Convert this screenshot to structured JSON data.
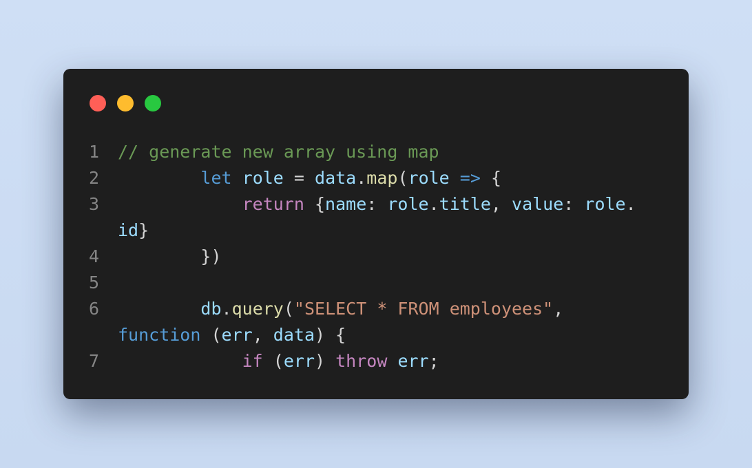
{
  "window_controls": {
    "close_color": "#ff5f57",
    "minimize_color": "#febc2e",
    "maximize_color": "#28c840"
  },
  "code": {
    "lines": [
      {
        "n": "1",
        "segments": [
          {
            "t": "// generate new array using map",
            "c": "comment"
          }
        ]
      },
      {
        "n": "2",
        "segments": [
          {
            "t": "        ",
            "c": "punc"
          },
          {
            "t": "let",
            "c": "kw"
          },
          {
            "t": " ",
            "c": "punc"
          },
          {
            "t": "role",
            "c": "var"
          },
          {
            "t": " = ",
            "c": "punc"
          },
          {
            "t": "data",
            "c": "var"
          },
          {
            "t": ".",
            "c": "punc"
          },
          {
            "t": "map",
            "c": "fn"
          },
          {
            "t": "(",
            "c": "punc"
          },
          {
            "t": "role",
            "c": "var"
          },
          {
            "t": " ",
            "c": "punc"
          },
          {
            "t": "=>",
            "c": "kw"
          },
          {
            "t": " {",
            "c": "punc"
          }
        ]
      },
      {
        "n": "3",
        "segments": [
          {
            "t": "            ",
            "c": "punc"
          },
          {
            "t": "return",
            "c": "ctrl"
          },
          {
            "t": " {",
            "c": "punc"
          },
          {
            "t": "name",
            "c": "var"
          },
          {
            "t": ": ",
            "c": "punc"
          },
          {
            "t": "role",
            "c": "var"
          },
          {
            "t": ".",
            "c": "punc"
          },
          {
            "t": "title",
            "c": "var"
          },
          {
            "t": ", ",
            "c": "punc"
          },
          {
            "t": "value",
            "c": "var"
          },
          {
            "t": ": ",
            "c": "punc"
          },
          {
            "t": "role",
            "c": "var"
          },
          {
            "t": ".",
            "c": "punc"
          }
        ]
      },
      {
        "n": "",
        "segments": [
          {
            "t": "id",
            "c": "var"
          },
          {
            "t": "}",
            "c": "punc"
          }
        ]
      },
      {
        "n": "4",
        "segments": [
          {
            "t": "        })",
            "c": "punc"
          }
        ]
      },
      {
        "n": "5",
        "segments": []
      },
      {
        "n": "6",
        "segments": [
          {
            "t": "        ",
            "c": "punc"
          },
          {
            "t": "db",
            "c": "var"
          },
          {
            "t": ".",
            "c": "punc"
          },
          {
            "t": "query",
            "c": "fn"
          },
          {
            "t": "(",
            "c": "punc"
          },
          {
            "t": "\"SELECT * FROM employees\"",
            "c": "str"
          },
          {
            "t": ",",
            "c": "punc"
          }
        ]
      },
      {
        "n": "",
        "segments": [
          {
            "t": "function",
            "c": "kw"
          },
          {
            "t": " (",
            "c": "punc"
          },
          {
            "t": "err",
            "c": "var"
          },
          {
            "t": ", ",
            "c": "punc"
          },
          {
            "t": "data",
            "c": "var"
          },
          {
            "t": ") {",
            "c": "punc"
          }
        ]
      },
      {
        "n": "7",
        "segments": [
          {
            "t": "            ",
            "c": "punc"
          },
          {
            "t": "if",
            "c": "ctrl"
          },
          {
            "t": " (",
            "c": "punc"
          },
          {
            "t": "err",
            "c": "var"
          },
          {
            "t": ") ",
            "c": "punc"
          },
          {
            "t": "throw",
            "c": "ctrl"
          },
          {
            "t": " ",
            "c": "punc"
          },
          {
            "t": "err",
            "c": "var"
          },
          {
            "t": ";",
            "c": "punc"
          }
        ]
      }
    ]
  }
}
